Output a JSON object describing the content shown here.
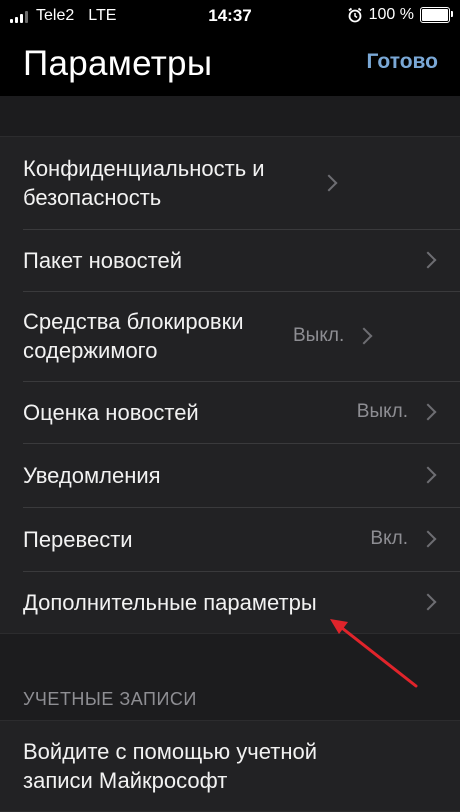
{
  "status_bar": {
    "carrier": "Tele2",
    "network": "LTE",
    "time": "14:37",
    "battery_text": "100 %",
    "battery_level": 1.0,
    "icons": [
      "signal-icon",
      "alarm-icon",
      "battery-icon"
    ]
  },
  "nav": {
    "title": "Параметры",
    "done_label": "Готово",
    "accent_color": "#7aa8d6"
  },
  "settings": {
    "items": [
      {
        "label": "Конфиденциальность и безопасность",
        "value": ""
      },
      {
        "label": "Пакет новостей",
        "value": ""
      },
      {
        "label": "Средства блокировки содержимого",
        "value": "Выкл."
      },
      {
        "label": "Оценка новостей",
        "value": "Выкл."
      },
      {
        "label": "Уведомления",
        "value": ""
      },
      {
        "label": "Перевести",
        "value": "Вкл."
      },
      {
        "label": "Дополнительные параметры",
        "value": ""
      }
    ]
  },
  "accounts": {
    "header": "УЧЕТНЫЕ ЗАПИСИ",
    "signin_label": "Войдите с помощью учетной записи Майкрософт"
  },
  "annotation": {
    "arrow_color": "#e0242b"
  }
}
